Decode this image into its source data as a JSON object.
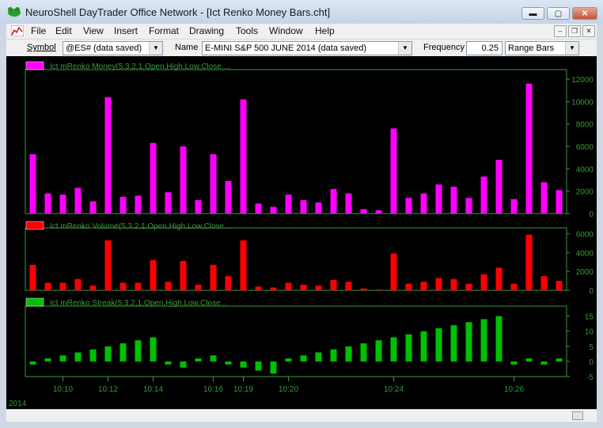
{
  "window": {
    "title": "NeuroShell DayTrader Office Network - [Ict Renko Money Bars.cht]",
    "minimize_glyph": "▬",
    "maximize_glyph": "▢",
    "close_glyph": "✕"
  },
  "menu": {
    "items": [
      "File",
      "Edit",
      "View",
      "Insert",
      "Format",
      "Drawing",
      "Tools",
      "Window",
      "Help"
    ],
    "mdi_minimize": "–",
    "mdi_restore": "❐",
    "mdi_close": "✕"
  },
  "toolbar": {
    "symbol_label": "Symbol",
    "symbol_value": "@ES# (data saved)",
    "name_label": "Name",
    "name_value": "E-MINI S&P 500 JUNE 2014 (data saved)",
    "frequency_label": "Frequency",
    "frequency_value": "0.25",
    "bar_type_value": "Range Bars",
    "dropdown_glyph": "▼"
  },
  "colors": {
    "money": "#ff00ff",
    "volume": "#ff0000",
    "streak": "#00c000",
    "axis": "#3a9a3a",
    "axis_text": "#3a9a3a"
  },
  "chart_data": [
    {
      "type": "bar",
      "legend": "Ict mRenko Money(5,3,2,1,Open,High,Low,Close,...",
      "ylim": [
        0,
        12500
      ],
      "yticks": [
        0,
        2000,
        4000,
        6000,
        8000,
        10000,
        12000
      ],
      "values": [
        5300,
        1800,
        1700,
        2300,
        1100,
        10400,
        1500,
        1600,
        6300,
        1900,
        6000,
        1200,
        5300,
        2900,
        10200,
        900,
        600,
        1700,
        1200,
        1000,
        2200,
        1800,
        400,
        300,
        7600,
        1400,
        1800,
        2600,
        2400,
        1400,
        3300,
        4800,
        1300,
        11600,
        2800,
        2100
      ]
    },
    {
      "type": "bar",
      "legend": "Ict mRenko Volume(5,3,2,1,Open,High,Low,Close...",
      "ylim": [
        0,
        6200
      ],
      "yticks": [
        0,
        2000,
        4000,
        6000
      ],
      "values": [
        2700,
        800,
        800,
        1200,
        500,
        5300,
        800,
        800,
        3200,
        900,
        3100,
        600,
        2700,
        1500,
        5300,
        400,
        300,
        800,
        600,
        500,
        1100,
        900,
        200,
        100,
        3900,
        700,
        900,
        1300,
        1200,
        700,
        1700,
        2400,
        700,
        5900,
        1500,
        1000
      ]
    },
    {
      "type": "bar",
      "legend": "Ict mRenko Streak(5,3,2,1,Open,High,Low,Close...",
      "ylim": [
        -5,
        17
      ],
      "yticks": [
        15,
        10,
        5,
        0,
        -5
      ],
      "values": [
        -1,
        1,
        2,
        3,
        4,
        5,
        6,
        7,
        8,
        -1,
        -2,
        1,
        2,
        -1,
        -2,
        -3,
        -4,
        1,
        2,
        3,
        4,
        5,
        6,
        7,
        8,
        9,
        10,
        11,
        12,
        13,
        14,
        15,
        -1,
        1,
        -1,
        1
      ]
    }
  ],
  "x_axis": {
    "year_label": "2014",
    "ticks": [
      {
        "label": "10:10",
        "bar": 2
      },
      {
        "label": "10:12",
        "bar": 5
      },
      {
        "label": "10:14",
        "bar": 8
      },
      {
        "label": "10:16",
        "bar": 12
      },
      {
        "label": "10:19",
        "bar": 14
      },
      {
        "label": "10:20",
        "bar": 17
      },
      {
        "label": "10:24",
        "bar": 24
      },
      {
        "label": "10:26",
        "bar": 32
      }
    ]
  }
}
